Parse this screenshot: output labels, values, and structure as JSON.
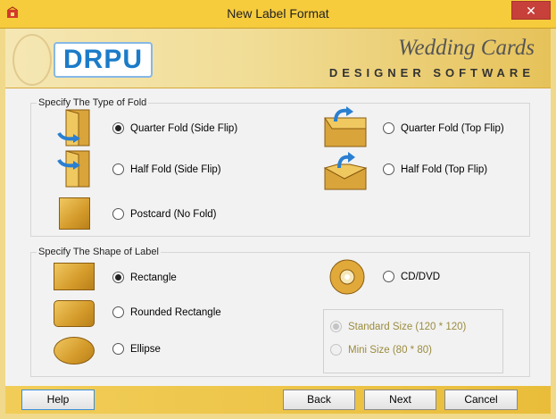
{
  "window": {
    "title": "New Label Format",
    "close_glyph": "✕"
  },
  "banner": {
    "logo_text": "DRPU",
    "brand_line1": "Wedding Cards",
    "brand_line2": "DESIGNER SOFTWARE"
  },
  "fold_group": {
    "legend": "Specify The Type of Fold",
    "options": [
      {
        "label": "Quarter Fold (Side Flip)",
        "selected": true
      },
      {
        "label": "Half Fold (Side Flip)",
        "selected": false
      },
      {
        "label": "Postcard (No Fold)",
        "selected": false
      },
      {
        "label": "Quarter Fold (Top Flip)",
        "selected": false
      },
      {
        "label": "Half Fold (Top Flip)",
        "selected": false
      }
    ]
  },
  "shape_group": {
    "legend": "Specify The Shape of Label",
    "options": [
      {
        "label": "Rectangle",
        "selected": true
      },
      {
        "label": "Rounded Rectangle",
        "selected": false
      },
      {
        "label": "Ellipse",
        "selected": false
      },
      {
        "label": "CD/DVD",
        "selected": false
      }
    ],
    "cd_sizes": [
      {
        "label": "Standard Size (120 * 120)",
        "selected": true,
        "enabled": false
      },
      {
        "label": "Mini Size (80 * 80)",
        "selected": false,
        "enabled": false
      }
    ]
  },
  "buttons": {
    "help": "Help",
    "back": "Back",
    "next": "Next",
    "cancel": "Cancel"
  },
  "colors": {
    "titlebar": "#f6cb3c",
    "accent_gold": "#d49a2a",
    "logo_blue": "#1b7bc8",
    "close_red": "#c7403a"
  }
}
